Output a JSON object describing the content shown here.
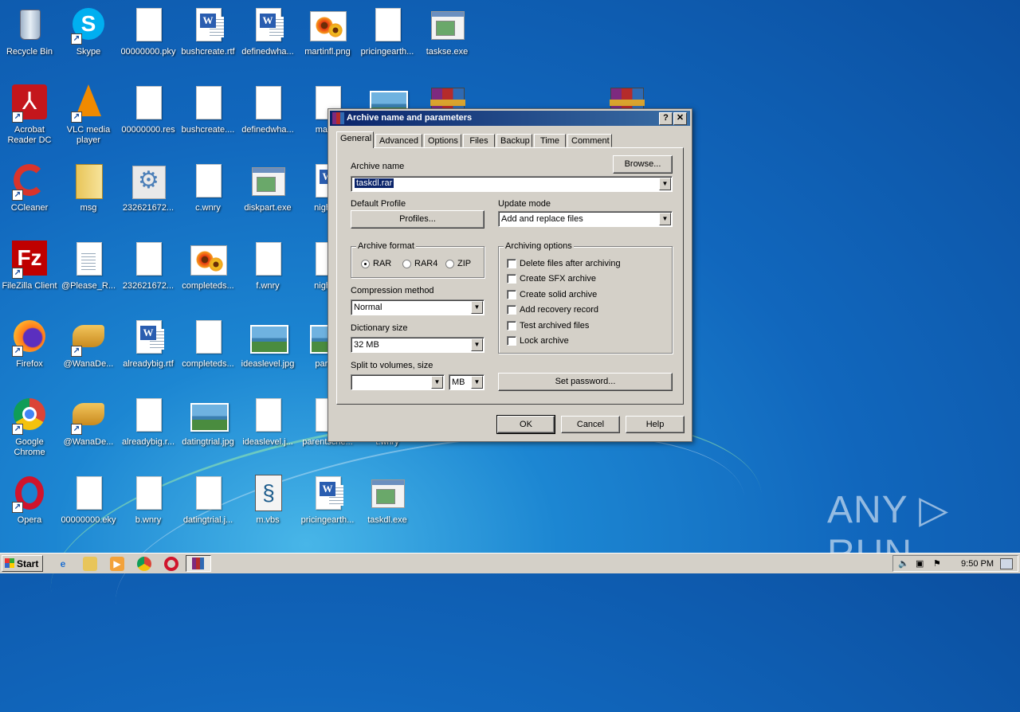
{
  "desktop": {
    "icons": [
      {
        "label": "Recycle Bin"
      },
      {
        "label": "Skype"
      },
      {
        "label": "00000000.pky"
      },
      {
        "label": "bushcreate.rtf"
      },
      {
        "label": "definedwha..."
      },
      {
        "label": "martinfl.png"
      },
      {
        "label": "pricingearth..."
      },
      {
        "label": "taskse.exe"
      },
      {
        "label": "Acrobat Reader DC"
      },
      {
        "label": "VLC media player"
      },
      {
        "label": "00000000.res"
      },
      {
        "label": "bushcreate...."
      },
      {
        "label": "definedwha..."
      },
      {
        "label": "martin"
      },
      {
        "label": "CCleaner"
      },
      {
        "label": "msg"
      },
      {
        "label": "232621672..."
      },
      {
        "label": "c.wnry"
      },
      {
        "label": "diskpart.exe"
      },
      {
        "label": "nightor"
      },
      {
        "label": "FileZilla Client"
      },
      {
        "label": "@Please_R..."
      },
      {
        "label": "232621672..."
      },
      {
        "label": "completeds..."
      },
      {
        "label": "f.wnry"
      },
      {
        "label": "nightor"
      },
      {
        "label": "Firefox"
      },
      {
        "label": "@WanaDe..."
      },
      {
        "label": "alreadybig.rtf"
      },
      {
        "label": "completeds..."
      },
      {
        "label": "ideaslevel.jpg"
      },
      {
        "label": "parent"
      },
      {
        "label": "Google Chrome"
      },
      {
        "label": "@WanaDe..."
      },
      {
        "label": "alreadybig.r..."
      },
      {
        "label": "datingtrial.jpg"
      },
      {
        "label": "ideaslevel.j..."
      },
      {
        "label": "parentsche..."
      },
      {
        "label": "t.wnry"
      },
      {
        "label": "Opera"
      },
      {
        "label": "00000000.eky"
      },
      {
        "label": "b.wnry"
      },
      {
        "label": "datingtrial.j..."
      },
      {
        "label": "m.vbs"
      },
      {
        "label": "pricingearth..."
      },
      {
        "label": "taskdl.exe"
      }
    ]
  },
  "dialog": {
    "title": "Archive name and parameters",
    "help_btn": "?",
    "close_btn": "✕",
    "tabs": [
      "General",
      "Advanced",
      "Options",
      "Files",
      "Backup",
      "Time",
      "Comment"
    ],
    "active_tab": "General",
    "archive_name_label": "Archive name",
    "archive_name_value": "taskdl.rar",
    "browse_btn": "Browse...",
    "default_profile_label": "Default Profile",
    "profiles_btn": "Profiles...",
    "update_mode_label": "Update mode",
    "update_mode_value": "Add and replace files",
    "archive_format_label": "Archive format",
    "formats": [
      "RAR",
      "RAR4",
      "ZIP"
    ],
    "selected_format": "RAR",
    "compression_label": "Compression method",
    "compression_value": "Normal",
    "dictionary_label": "Dictionary size",
    "dictionary_value": "32 MB",
    "split_label": "Split to volumes, size",
    "split_value": "",
    "split_unit": "MB",
    "archiving_options_label": "Archiving options",
    "options": [
      {
        "label": "Delete files after archiving",
        "checked": false
      },
      {
        "label": "Create SFX archive",
        "checked": false
      },
      {
        "label": "Create solid archive",
        "checked": false
      },
      {
        "label": "Add recovery record",
        "checked": false
      },
      {
        "label": "Test archived files",
        "checked": false
      },
      {
        "label": "Lock archive",
        "checked": false
      }
    ],
    "set_password_btn": "Set password...",
    "ok_btn": "OK",
    "cancel_btn": "Cancel",
    "help_button": "Help"
  },
  "taskbar": {
    "start_label": "Start",
    "clock": "9:50 PM"
  },
  "watermark": "ANY ▷ RUN"
}
